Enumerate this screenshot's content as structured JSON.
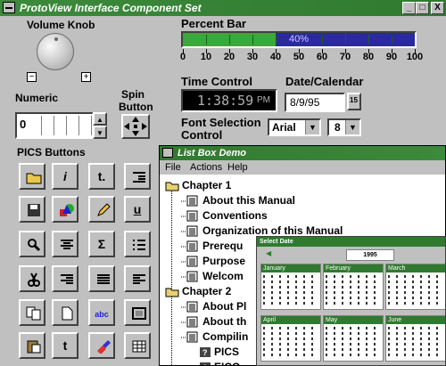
{
  "window": {
    "title": "ProtoView Interface Component Set",
    "controls": {
      "minimize": "_",
      "maximize": "□",
      "close": "X"
    }
  },
  "volume_knob": {
    "label": "Volume Knob",
    "minus": "−",
    "plus": "+"
  },
  "percent_bar": {
    "label": "Percent Bar",
    "value_text": "40%",
    "fraction": 0.4,
    "scale": [
      "0",
      "10",
      "20",
      "30",
      "40",
      "50",
      "60",
      "70",
      "80",
      "90",
      "100"
    ]
  },
  "time_control": {
    "label": "Time Control",
    "value": "1:38:59",
    "ampm": "PM"
  },
  "date_calendar": {
    "label": "Date/Calendar",
    "value": "8/9/95",
    "button": "15"
  },
  "numeric": {
    "label": "Numeric",
    "value": "0"
  },
  "spin_button": {
    "label_line1": "Spin",
    "label_line2": "Button"
  },
  "font_selection": {
    "label_line1": "Font Selection",
    "label_line2": "Control",
    "font": "Arial",
    "size": "8"
  },
  "pics_buttons": {
    "label": "PICS Buttons",
    "buttons": [
      {
        "icon": "open-folder-icon"
      },
      {
        "icon": "italic-icon",
        "text": "i"
      },
      {
        "icon": "up-arrow-icon",
        "text": "t."
      },
      {
        "icon": "indent-icon"
      },
      {
        "icon": "save-icon"
      },
      {
        "icon": "shapes-icon"
      },
      {
        "icon": "pencil-icon"
      },
      {
        "icon": "underline-icon",
        "text": "u"
      },
      {
        "icon": "magnifier-icon"
      },
      {
        "icon": "center-align-icon"
      },
      {
        "icon": "sigma-icon",
        "text": "Σ"
      },
      {
        "icon": "bullet-list-icon"
      },
      {
        "icon": "scissors-icon"
      },
      {
        "icon": "right-align-icon"
      },
      {
        "icon": "justify-icon"
      },
      {
        "icon": "left-align-icon"
      },
      {
        "icon": "copy-icon"
      },
      {
        "icon": "new-document-icon"
      },
      {
        "icon": "spellcheck-icon",
        "text": "abc"
      },
      {
        "icon": "frame-icon"
      },
      {
        "icon": "paste-icon"
      },
      {
        "icon": "up-arrow-icon",
        "text": "t"
      },
      {
        "icon": "paint-icon"
      },
      {
        "icon": "table-icon"
      }
    ]
  },
  "list_box": {
    "title": "List Box Demo",
    "menu": [
      "File",
      "Actions",
      "Help"
    ],
    "items": [
      {
        "text": "Chapter 1",
        "type": "folder"
      },
      {
        "text": "About this Manual",
        "type": "doc"
      },
      {
        "text": "Conventions",
        "type": "doc"
      },
      {
        "text": "Organization of this Manual",
        "type": "doc"
      },
      {
        "text": "Prerequ",
        "type": "doc"
      },
      {
        "text": "Purpose",
        "type": "doc"
      },
      {
        "text": "Welcom",
        "type": "doc"
      },
      {
        "text": "Chapter 2",
        "type": "folder"
      },
      {
        "text": "About Pl",
        "type": "doc"
      },
      {
        "text": "About th",
        "type": "doc"
      },
      {
        "text": "Compilin",
        "type": "doc"
      },
      {
        "text": "PICS",
        "type": "help"
      },
      {
        "text": "EICO",
        "type": "help"
      }
    ]
  },
  "calendar_popup": {
    "title": "Select Date",
    "year": "1995",
    "months": [
      "January",
      "February",
      "March",
      "April",
      "May",
      "June"
    ]
  },
  "colors": {
    "title_green": "#2f7a2f",
    "bar_green": "#3aa83a",
    "bar_blue": "#2a2a9a"
  }
}
